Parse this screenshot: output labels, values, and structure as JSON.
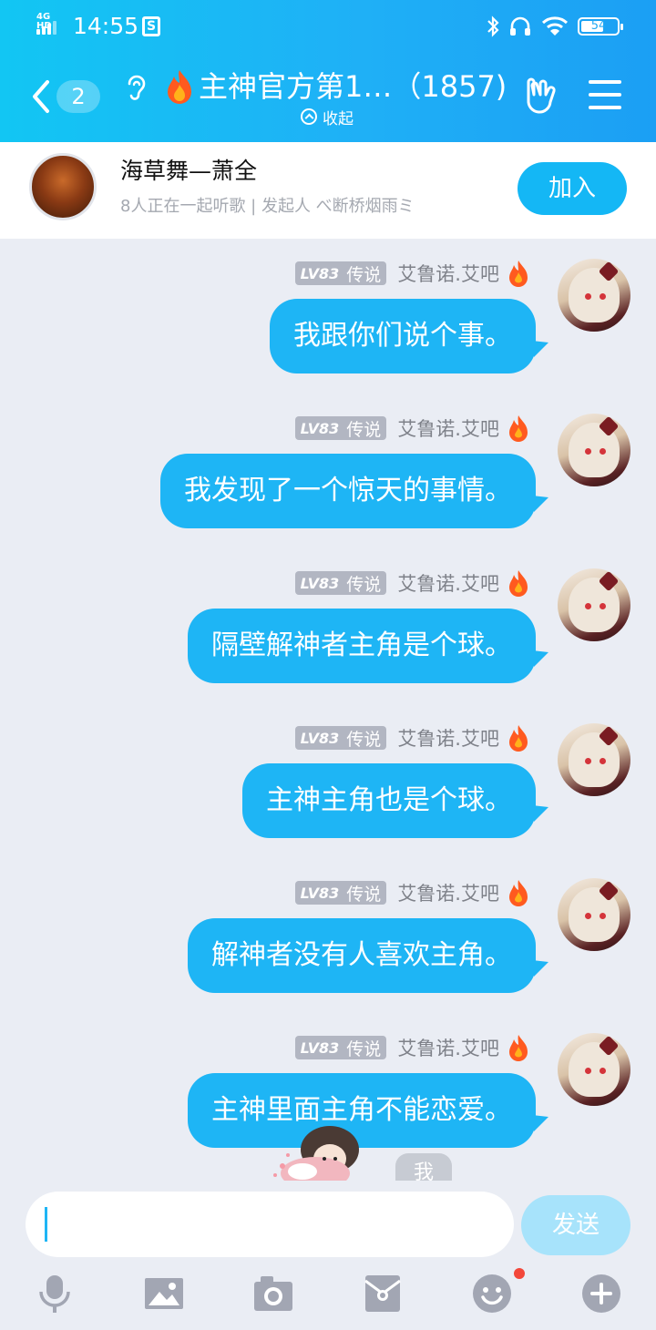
{
  "status_bar": {
    "network": "4G HD",
    "time": "14:55",
    "battery": "54"
  },
  "header": {
    "back_badge": "2",
    "title": "主神官方第1…（1857)",
    "collapse_label": "收起"
  },
  "listen_together": {
    "title": "海草舞—萧全",
    "subtitle": "8人正在一起听歌 | 发起人 べ断桥烟雨ミ",
    "join_label": "加入"
  },
  "messages": [
    {
      "level": "LV83",
      "title": "传说",
      "sender": "艾鲁诺.艾吧",
      "text": "我跟你们说个事。"
    },
    {
      "level": "LV83",
      "title": "传说",
      "sender": "艾鲁诺.艾吧",
      "text": "我发现了一个惊天的事情。"
    },
    {
      "level": "LV83",
      "title": "传说",
      "sender": "艾鲁诺.艾吧",
      "text": "隔壁解神者主角是个球。"
    },
    {
      "level": "LV83",
      "title": "传说",
      "sender": "艾鲁诺.艾吧",
      "text": "主神主角也是个球。"
    },
    {
      "level": "LV83",
      "title": "传说",
      "sender": "艾鲁诺.艾吧",
      "text": "解神者没有人喜欢主角。"
    },
    {
      "level": "LV83",
      "title": "传说",
      "sender": "艾鲁诺.艾吧",
      "text": "主神里面主角不能恋爱。"
    }
  ],
  "quick_reply": "我",
  "input": {
    "value": "",
    "send_label": "发送"
  },
  "toolbar": [
    "microphone-icon",
    "image-icon",
    "camera-icon",
    "red-packet-icon",
    "emoji-icon",
    "plus-icon"
  ],
  "colors": {
    "header": "#1fb0f6",
    "bubble": "#1eb5f5",
    "join": "#14b7f5",
    "send_disabled": "#a7e3fb",
    "background": "#eaedf4"
  }
}
